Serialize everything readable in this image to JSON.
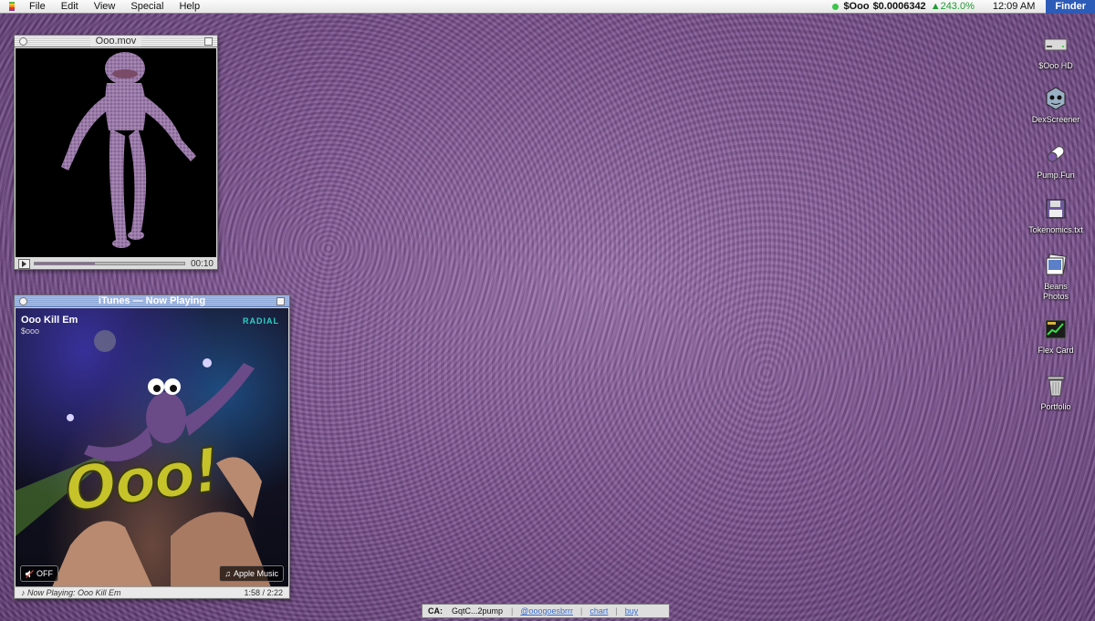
{
  "menubar": {
    "items": [
      "File",
      "Edit",
      "View",
      "Special",
      "Help"
    ],
    "ticker": {
      "symbol": "$Ooo",
      "price": "$0.0006342",
      "change": "▲243.0%"
    },
    "clock": "12:09 AM",
    "active_app": "Finder"
  },
  "movie_window": {
    "title": "Ooo.mov",
    "time": "00:10",
    "progress": 0.4
  },
  "itunes_window": {
    "title": "iTunes — Now Playing",
    "track": "Ooo Kill Em",
    "artist": "$ooo",
    "station": "RADIAL",
    "art_text": "Ooo!",
    "off_label": "OFF",
    "service_label": "Apple Music",
    "now_playing": "Now Playing: Ooo Kill Em",
    "time": "1:58 / 2:22"
  },
  "desktop_icons": [
    {
      "label": "$Ooo HD",
      "icon": "hard-drive-icon"
    },
    {
      "label": "DexScreener",
      "icon": "dexscreener-icon"
    },
    {
      "label": "Pump.Fun",
      "icon": "pill-icon"
    },
    {
      "label": "Tokenomics.txt",
      "icon": "floppy-disk-icon"
    },
    {
      "label": "Beans Photos",
      "icon": "photos-icon"
    },
    {
      "label": "Flex Card",
      "icon": "chart-card-icon"
    },
    {
      "label": "Portfolio",
      "icon": "trash-icon"
    }
  ],
  "ca_bar": {
    "label": "CA:",
    "address": "GqtC...2pump",
    "links": [
      "@ooogoesbrrr",
      "chart",
      "buy"
    ]
  },
  "colors": {
    "accent": "#2d5bb8",
    "ticker_up": "#1e9b32",
    "radial": "#2fd0c4",
    "link": "#3a6fd0"
  }
}
